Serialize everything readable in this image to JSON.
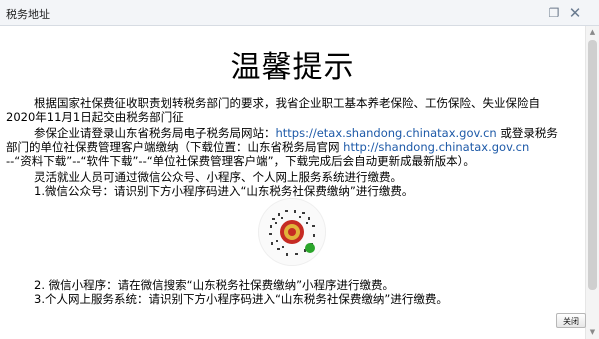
{
  "window": {
    "title": "税务地址"
  },
  "notice": {
    "heading": "温馨提示",
    "p1_line1": "根据国家社保费征收职责划转税务部门的要求，我省企业职工基本养老保险、工伤保险、失业保险自",
    "p1_line2": "2020年11月1日起交由税务部门征",
    "p2_prefix": "参保企业请登录山东省税务局电子税务局网站：",
    "p2_link": "https://etax.shandong.chinatax.gov.cn",
    "p2_suffix": " 或登录税务",
    "p2_line2_prefix": "部门的单位社保费管理客户端缴纳（下载位置：山东省税务局官网 ",
    "p2_link2": "http://shandong.chinatax.gov.cn",
    "p2_line3": "--“资料下载”--“软件下载”--“单位社保费管理客户端”，下载完成后会自动更新成最新版本）。",
    "p3": "灵活就业人员可通过微信公众号、小程序、个人网上服务系统进行缴费。",
    "p4": "1.微信公众号：请识别下方小程序码进入“山东税务社保费缴纳”进行缴费。",
    "p5": "2. 微信小程序：请在微信搜索“山东税务社保费缴纳”小程序进行缴费。",
    "p6": "3.个人网上服务系统：请识别下方小程序码进入“山东税务社保费缴纳”进行缴费。"
  },
  "buttons": {
    "close_label": "关闭"
  },
  "icons": {
    "restore": "restore-icon",
    "close": "close-icon",
    "qr": "mini-program-code-icon"
  }
}
